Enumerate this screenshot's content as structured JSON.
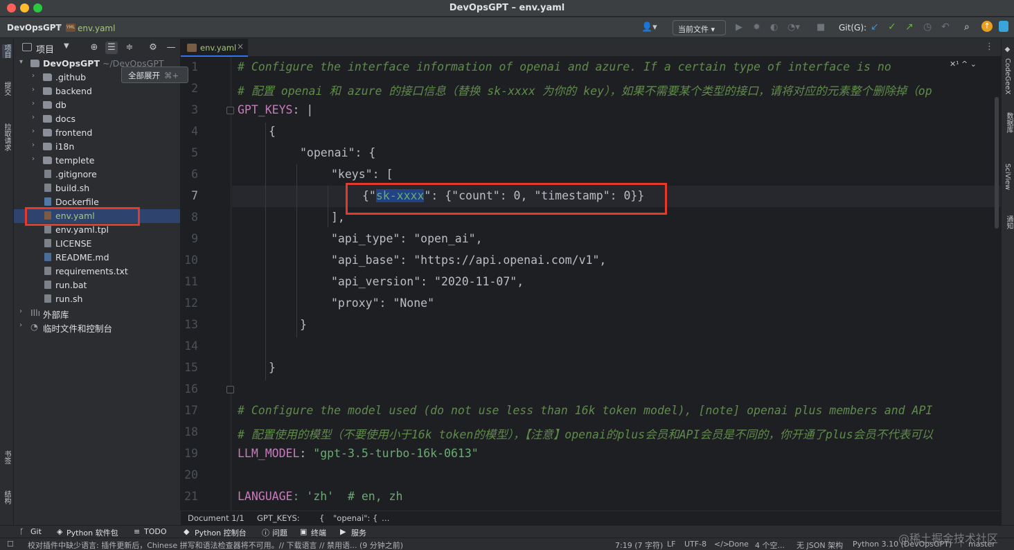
{
  "window": {
    "title": "DevOpsGPT – env.yaml"
  },
  "navbar": {
    "project": "DevOpsGPT",
    "file": "env.yaml",
    "file_icon": "YML",
    "run_config": "当前文件 ▾",
    "git_label": "Git(G):"
  },
  "left_stripe": {
    "project": "项目",
    "commit": "提交",
    "pull_requests": "拉取请求",
    "bookmarks": "书签",
    "structure": "结构"
  },
  "project_panel": {
    "title": "项目",
    "root": {
      "name": "DevOpsGPT",
      "path": "~/DevOpsGPT"
    },
    "tooltip": {
      "label": "全部展开",
      "shortcut": "⌘+"
    },
    "folders": [
      ".github",
      "backend",
      "db",
      "docs",
      "frontend",
      "i18n",
      "templete"
    ],
    "files": [
      ".gitignore",
      "build.sh",
      "Dockerfile",
      "env.yaml",
      "env.yaml.tpl",
      "LICENSE",
      "README.md",
      "requirements.txt",
      "run.bat",
      "run.sh"
    ],
    "external": [
      "外部库",
      "临时文件和控制台"
    ]
  },
  "editor": {
    "tab": {
      "label": "env.yaml",
      "icon": "YML"
    },
    "inspection": "✕¹ ^ ⌄",
    "line_numbers": [
      "1",
      "2",
      "3",
      "4",
      "5",
      "6",
      "7",
      "8",
      "9",
      "10",
      "11",
      "12",
      "13",
      "14",
      "15",
      "16",
      "17",
      "18",
      "19",
      "20",
      "21"
    ],
    "lines": {
      "l1": "# Configure the interface information of openai and azure. If a certain type of interface is no",
      "l2": "# 配置 openai 和 azure 的接口信息（替换 sk-xxxx 为你的 key），如果不需要某个类型的接口，请将对应的元素整个删除掉（op",
      "l3_key": "GPT_KEYS",
      "l3_rest": ": |",
      "l4": "{",
      "l5_str": "\"openai\"",
      "l5_rest": ": {",
      "l6_str": "\"keys\"",
      "l6_rest": ": [",
      "l7_a": "{\"",
      "l7_sel": "sk-xxxx",
      "l7_b": "\": {\"count\": 0, \"timestamp\": 0}}",
      "l8": "],",
      "l9": "\"api_type\": \"open_ai\",",
      "l10": "\"api_base\": \"https://api.openai.com/v1\",",
      "l11": "\"api_version\": \"2020-11-07\",",
      "l12": "\"proxy\": \"None\"",
      "l13": "}",
      "l15": "}",
      "l17": "# Configure the model used (do not use less than 16k token model), [note] openai plus members and API",
      "l18": "# 配置使用的模型（不要使用小于16k token的模型），【注意】openai的plus会员和API会员是不同的，你开通了plus会员不代表可以",
      "l19_key": "LLM_MODEL",
      "l19_str": "\"gpt-3.5-turbo-16k-0613\"",
      "l21_key": "LANGUAGE",
      "l21_rest": ": 'zh'  # en, zh"
    },
    "breadcrumbs": [
      "Document 1/1",
      "GPT_KEYS:",
      "{",
      "\"openai\": {",
      "…"
    ]
  },
  "right_stripe": {
    "codegeex": "CodeGeeX",
    "database": "数据库",
    "sciview": "SciView",
    "notifications": "通知"
  },
  "bottom_tools": [
    "Git",
    "Python 软件包",
    "TODO",
    "Python 控制台",
    "问题",
    "终端",
    "服务"
  ],
  "status": {
    "message": "校对插件中缺少语言: 插件更新后，Chinese 拼写和语法检查器将不可用。// 下载语言 // 禁用语... (9 分钟之前)",
    "position": "7:19 (7 字符)",
    "line_sep": "LF",
    "encoding": "UTF-8",
    "done": "Done",
    "indent": "4 个空...",
    "schema": "无 JSON 架构",
    "interpreter": "Python 3.10 (DevOpsGPT)",
    "branch": "master"
  },
  "watermark": "@稀土掘金技术社区",
  "colors": {
    "highlight_box": "#e53a2a",
    "selection": "#214283",
    "accent": "#3574f0"
  }
}
